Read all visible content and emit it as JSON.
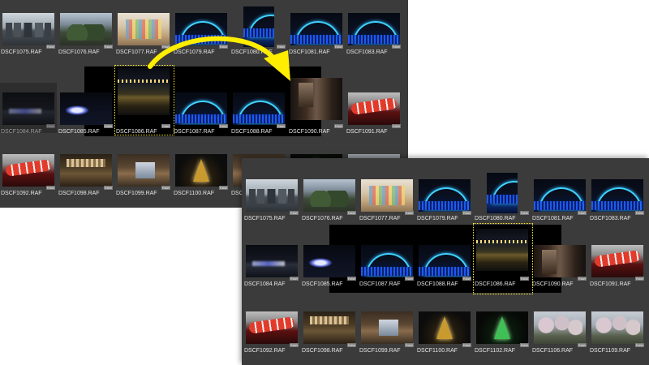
{
  "panel_before": {
    "row1": [
      "DSCF1075.RAF",
      "DSCF1076.RAF",
      "DSCF1077.RAF",
      "DSCF1079.RAF",
      "DSCF1080.RAF",
      "DSCF1081.RAF",
      "DSCF1083.RAF"
    ],
    "row2": [
      "DSCF1084.RAF",
      "DSCF1085.RAF",
      "DSCF1086.RAF",
      "DSCF1087.RAF",
      "DSCF1088.RAF",
      "DSCF1090.RAF",
      "DSCF1091.RAF"
    ],
    "row3": [
      "DSCF1092.RAF",
      "DSCF1098.RAF",
      "DSCF1099.RAF",
      "DSCF1100.RAF",
      "DSC"
    ]
  },
  "panel_after": {
    "row1": [
      "DSCF1075.RAF",
      "DSCF1076.RAF",
      "DSCF1077.RAF",
      "DSCF1079.RAF",
      "DSCF1080.RAF",
      "DSCF1081.RAF",
      "DSCF1083.RAF"
    ],
    "row2": [
      "DSCF1084.RAF",
      "DSCF1085.RAF",
      "DSCF1087.RAF",
      "DSCF1088.RAF",
      "DSCF1086.RAF",
      "DSCF1090.RAF",
      "DSCF1091.RAF"
    ],
    "row3": [
      "DSCF1092.RAF",
      "DSCF1098.RAF",
      "DSCF1099.RAF",
      "DSCF1100.RAF",
      "DSCF1102.RAF",
      "DSCF1106.RAF",
      "DSCF1109.RAF"
    ]
  },
  "raw_badge": "RAW",
  "colors": {
    "panel_bg": "#3b3b3b",
    "selection_border": "#ffee33",
    "arrow": "#ffee00"
  },
  "icons": {
    "drag_arrow": "curved-arrow-icon",
    "file_type_badge": "raw-badge-icon"
  }
}
